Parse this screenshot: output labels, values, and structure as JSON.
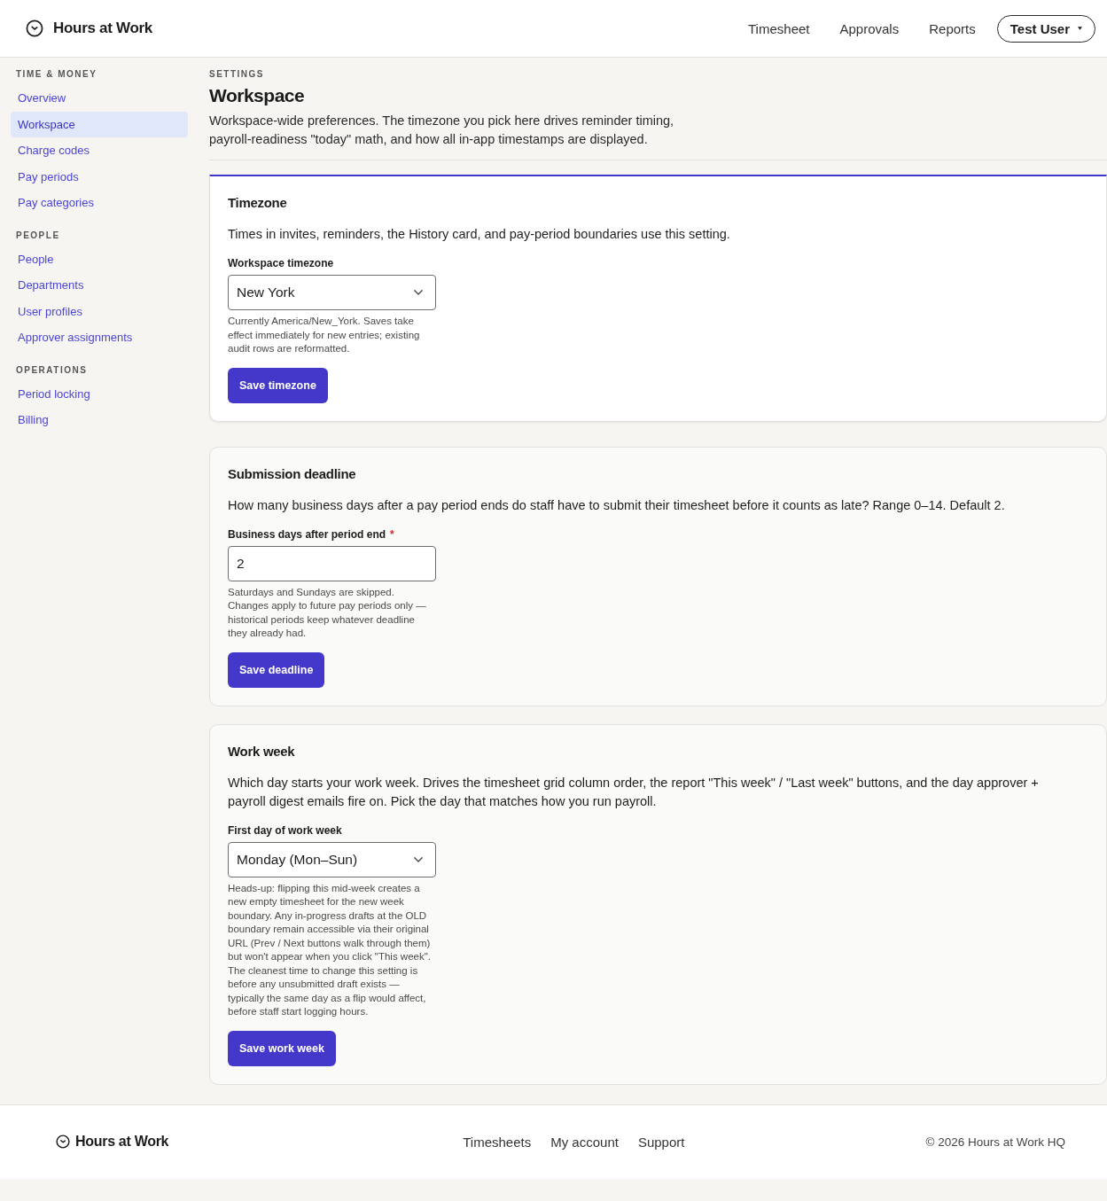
{
  "header": {
    "app_name": "Hours at Work",
    "nav": [
      "Timesheet",
      "Approvals",
      "Reports"
    ],
    "user_menu": "Test User"
  },
  "sidebar": {
    "sections": [
      {
        "heading": "TIME & MONEY",
        "items": [
          {
            "label": "Overview",
            "selected": false
          },
          {
            "label": "Workspace",
            "selected": true
          },
          {
            "label": "Charge codes",
            "selected": false
          },
          {
            "label": "Pay periods",
            "selected": false
          },
          {
            "label": "Pay categories",
            "selected": false
          }
        ]
      },
      {
        "heading": "PEOPLE",
        "items": [
          {
            "label": "People",
            "selected": false
          },
          {
            "label": "Departments",
            "selected": false
          },
          {
            "label": "User profiles",
            "selected": false
          },
          {
            "label": "Approver assignments",
            "selected": false
          }
        ]
      },
      {
        "heading": "OPERATIONS",
        "items": [
          {
            "label": "Period locking",
            "selected": false
          },
          {
            "label": "Billing",
            "selected": false
          }
        ]
      }
    ]
  },
  "page": {
    "eyebrow": "SETTINGS",
    "title": "Workspace",
    "description": "Workspace-wide preferences. The timezone you pick here drives reminder timing, payroll-readiness \"today\" math, and how all in-app timestamps are displayed."
  },
  "cards": [
    {
      "kind": "select",
      "highlighted": true,
      "title": "Timezone",
      "description": "Times in invites, reminders, the History card, and pay-period boundaries use this setting.",
      "field": {
        "label": "Workspace timezone",
        "value": "New York"
      },
      "help": "Currently America/New_York. Saves take effect immediately for new entries; existing audit rows are reformatted.",
      "button": "Save timezone"
    },
    {
      "kind": "number",
      "highlighted": false,
      "title": "Submission deadline",
      "description": "How many business days after a pay period ends do staff have to submit their timesheet before it counts as late? Range 0–14. Default 2.",
      "field": {
        "label": "Business days after period end",
        "required_mark": "*",
        "value": "2"
      },
      "help": "Saturdays and Sundays are skipped. Changes apply to future pay periods only — historical periods keep whatever deadline they already had.",
      "button": "Save deadline"
    },
    {
      "kind": "select",
      "highlighted": false,
      "title": "Work week",
      "description": "Which day starts your work week. Drives the timesheet grid column order, the report \"This week\" / \"Last week\" buttons, and the day approver + payroll digest emails fire on. Pick the day that matches how you run payroll.",
      "field": {
        "label": "First day of work week",
        "value": "Monday (Mon–Sun)"
      },
      "help": "Heads-up: flipping this mid-week creates a new empty timesheet for the new week boundary. Any in-progress drafts at the OLD boundary remain accessible via their original URL (Prev / Next buttons walk through them) but won't appear when you click \"This week\". The cleanest time to change this setting is before any unsubmitted draft exists — typically the same day as a flip would affect, before staff start logging hours.",
      "button": "Save work week"
    }
  ],
  "footer": {
    "app_name": "Hours at Work",
    "links": [
      "Timesheets",
      "My account",
      "Support"
    ],
    "copyright": "© 2026 Hours at Work HQ"
  }
}
